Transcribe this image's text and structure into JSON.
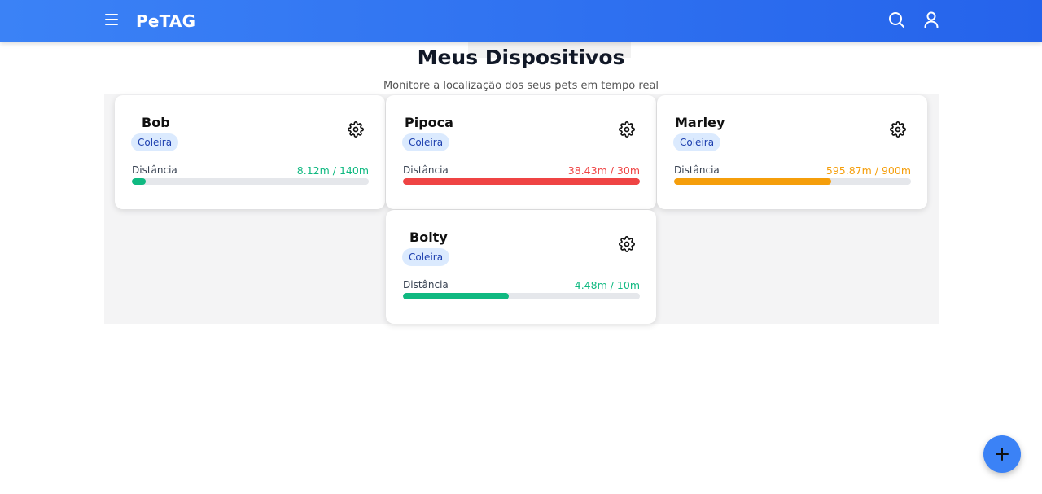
{
  "header": {
    "brand": "PeTAG",
    "menu_icon": "menu-icon",
    "search_icon": "search-icon",
    "user_icon": "user-icon"
  },
  "page": {
    "title": "Meus Dispositivos",
    "subtitle": "Monitore a localização dos seus pets em tempo real"
  },
  "devices": [
    {
      "name": "Bob",
      "type": "Coleira",
      "distance_label": "Distância",
      "distance_text": "8.12m / 140m",
      "fraction": 0.058,
      "color": "#10b981"
    },
    {
      "name": "Pipoca",
      "type": "Coleira",
      "distance_label": "Distância",
      "distance_text": "38.43m / 30m",
      "fraction": 1.0,
      "color": "#ef4444"
    },
    {
      "name": "Marley",
      "type": "Coleira",
      "distance_label": "Distância",
      "distance_text": "595.87m / 900m",
      "fraction": 0.662,
      "color": "#f59e0b"
    },
    {
      "name": "Bolty",
      "type": "Coleira",
      "distance_label": "Distância",
      "distance_text": "4.48m / 10m",
      "fraction": 0.448,
      "color": "#10b981"
    }
  ],
  "fab": {
    "icon": "plus-icon"
  },
  "colors": {
    "header_start": "#3b82f6",
    "header_end": "#2563eb",
    "accent": "#3b82f6"
  }
}
